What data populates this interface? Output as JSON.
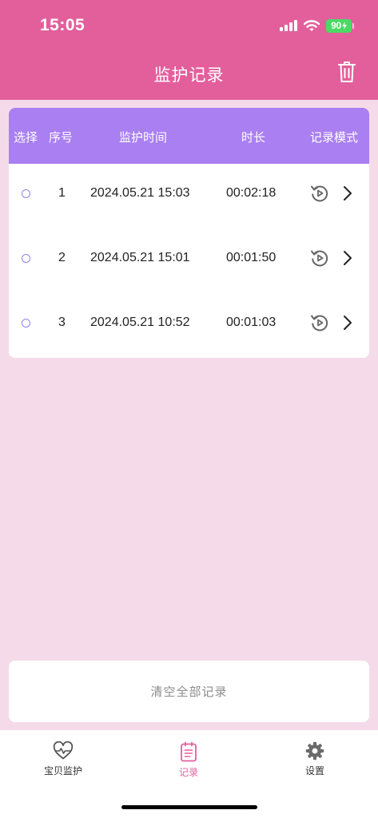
{
  "status_bar": {
    "time": "15:05",
    "battery": "90"
  },
  "header": {
    "title": "监护记录",
    "action_icon": "trash-icon"
  },
  "colors": {
    "header_bg": "#e35f9c",
    "table_header_bg": "#a97ff1",
    "page_bg": "#f5dbe9",
    "accent": "#e35f9c"
  },
  "table": {
    "columns": [
      "选择",
      "序号",
      "监护时间",
      "时长",
      "记录模式"
    ],
    "rows": [
      {
        "index": "1",
        "time": "2024.05.21 15:03",
        "duration": "00:02:18"
      },
      {
        "index": "2",
        "time": "2024.05.21 15:01",
        "duration": "00:01:50"
      },
      {
        "index": "3",
        "time": "2024.05.21 10:52",
        "duration": "00:01:03"
      }
    ],
    "mode_icon": "replay-icon",
    "detail_icon": "chevron-right-icon"
  },
  "clear_button": {
    "label": "清空全部记录"
  },
  "tabbar": {
    "tabs": [
      {
        "label": "宝贝监护",
        "icon": "heart-pulse-icon"
      },
      {
        "label": "记录",
        "icon": "clipboard-icon",
        "active": true
      },
      {
        "label": "设置",
        "icon": "gear-icon"
      }
    ]
  }
}
